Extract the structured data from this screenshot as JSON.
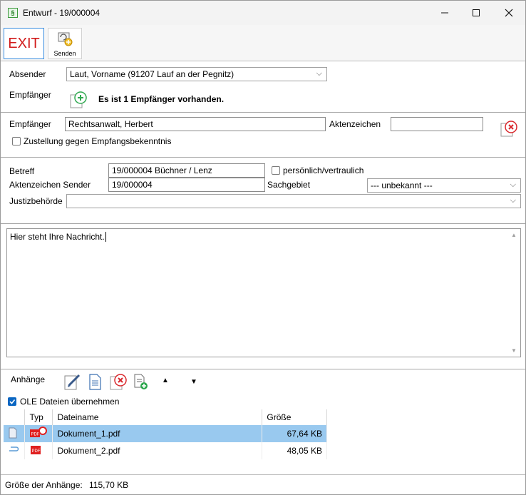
{
  "window": {
    "title": "Entwurf - 19/000004",
    "app_icon_glyph": "§"
  },
  "toolbar": {
    "exit_label": "EXIT",
    "send_label": "Senden"
  },
  "sender": {
    "label": "Absender",
    "value": "Laut, Vorname (91207 Lauf an der Pegnitz)"
  },
  "recipients": {
    "label": "Empfänger",
    "info": "Es ist 1 Empfänger vorhanden."
  },
  "recipient_detail": {
    "label": "Empfänger",
    "value": "Rechtsanwalt, Herbert",
    "aktenzeichen_label": "Aktenzeichen",
    "aktenzeichen_value": "",
    "zustellung_label": "Zustellung gegen Empfangsbekenntnis",
    "zustellung_checked": false
  },
  "case": {
    "betreff_label": "Betreff",
    "betreff_value": "19/000004  Büchner / Lenz",
    "persoenlich_label": "persönlich/vertraulich",
    "persoenlich_checked": false,
    "az_sender_label": "Aktenzeichen Sender",
    "az_sender_value": "19/000004",
    "sachgebiet_label": "Sachgebiet",
    "sachgebiet_value": "--- unbekannt ---",
    "justiz_label": "Justizbehörde",
    "justiz_value": ""
  },
  "message": {
    "text": "Hier steht Ihre Nachricht."
  },
  "attachments": {
    "label": "Anhänge",
    "ole_label": "OLE Dateien übernehmen",
    "ole_checked": true,
    "columns": [
      "",
      "Typ",
      "Dateiname",
      "Größe"
    ],
    "rows": [
      {
        "name": "Dokument_1.pdf",
        "size": "67,64 KB",
        "selected": true
      },
      {
        "name": "Dokument_2.pdf",
        "size": "48,05 KB",
        "selected": false
      }
    ]
  },
  "status": {
    "label": "Größe der Anhänge:",
    "value": "115,70 KB"
  },
  "colors": {
    "accent": "#0a66c2",
    "selection": "#99c9ef",
    "exit": "#d11a1a",
    "add_green": "#2fa84f",
    "delete_red": "#d9262b"
  }
}
